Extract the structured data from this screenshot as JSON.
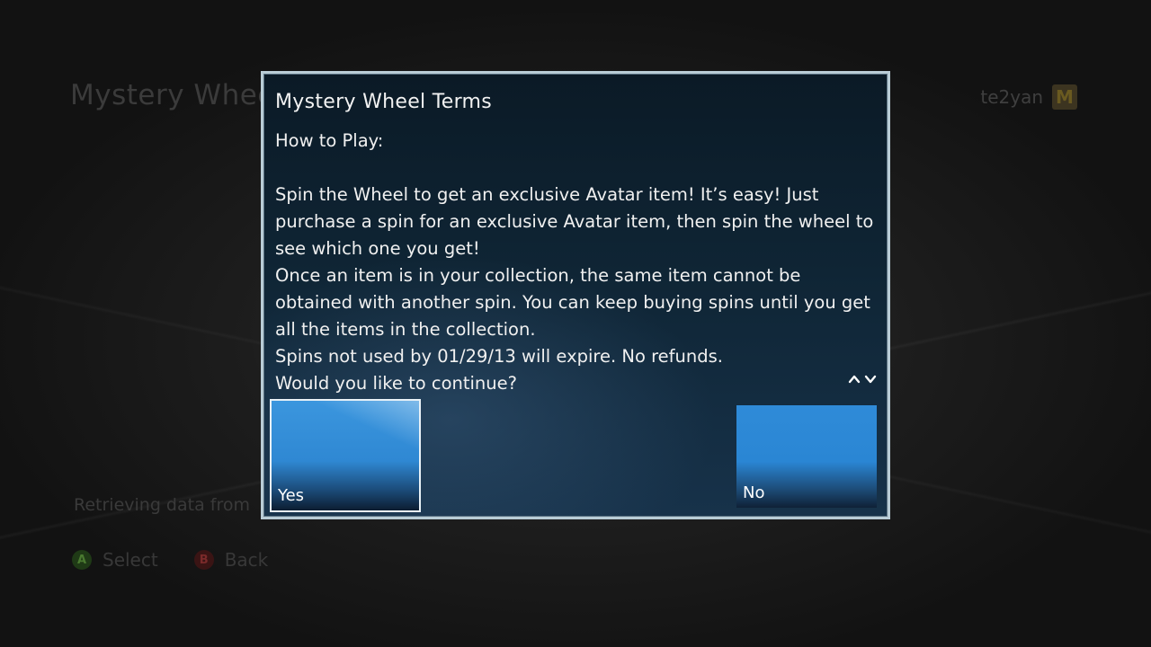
{
  "background": {
    "title": "Mystery Wheel",
    "gamertag": "te2yan",
    "gamerpic_icon": "mcdonalds-logo-icon",
    "status_text": "Retrieving data from",
    "controls": [
      {
        "button": "A",
        "label": "Select",
        "color": "#4a7a30"
      },
      {
        "button": "B",
        "label": "Back",
        "color": "#7a2a2a"
      }
    ]
  },
  "dialog": {
    "title": "Mystery Wheel Terms",
    "paragraphs": [
      "How to Play:",
      "",
      "Spin the Wheel to get an exclusive Avatar item! It’s easy! Just purchase a spin for an exclusive Avatar item, then spin the wheel to see which one you get!",
      "Once an item is in your collection, the same item cannot be obtained with another spin. You can keep buying spins until you get all the items in the collection.",
      "Spins not used by 01/29/13 will expire. No refunds.",
      "Would you like to continue?"
    ],
    "scroll_icons": [
      "chevron-up-icon",
      "chevron-down-icon"
    ],
    "buttons": {
      "yes": "Yes",
      "no": "No"
    },
    "accent_color": "#2f8bd8",
    "border_color": "#b9ccd6"
  }
}
